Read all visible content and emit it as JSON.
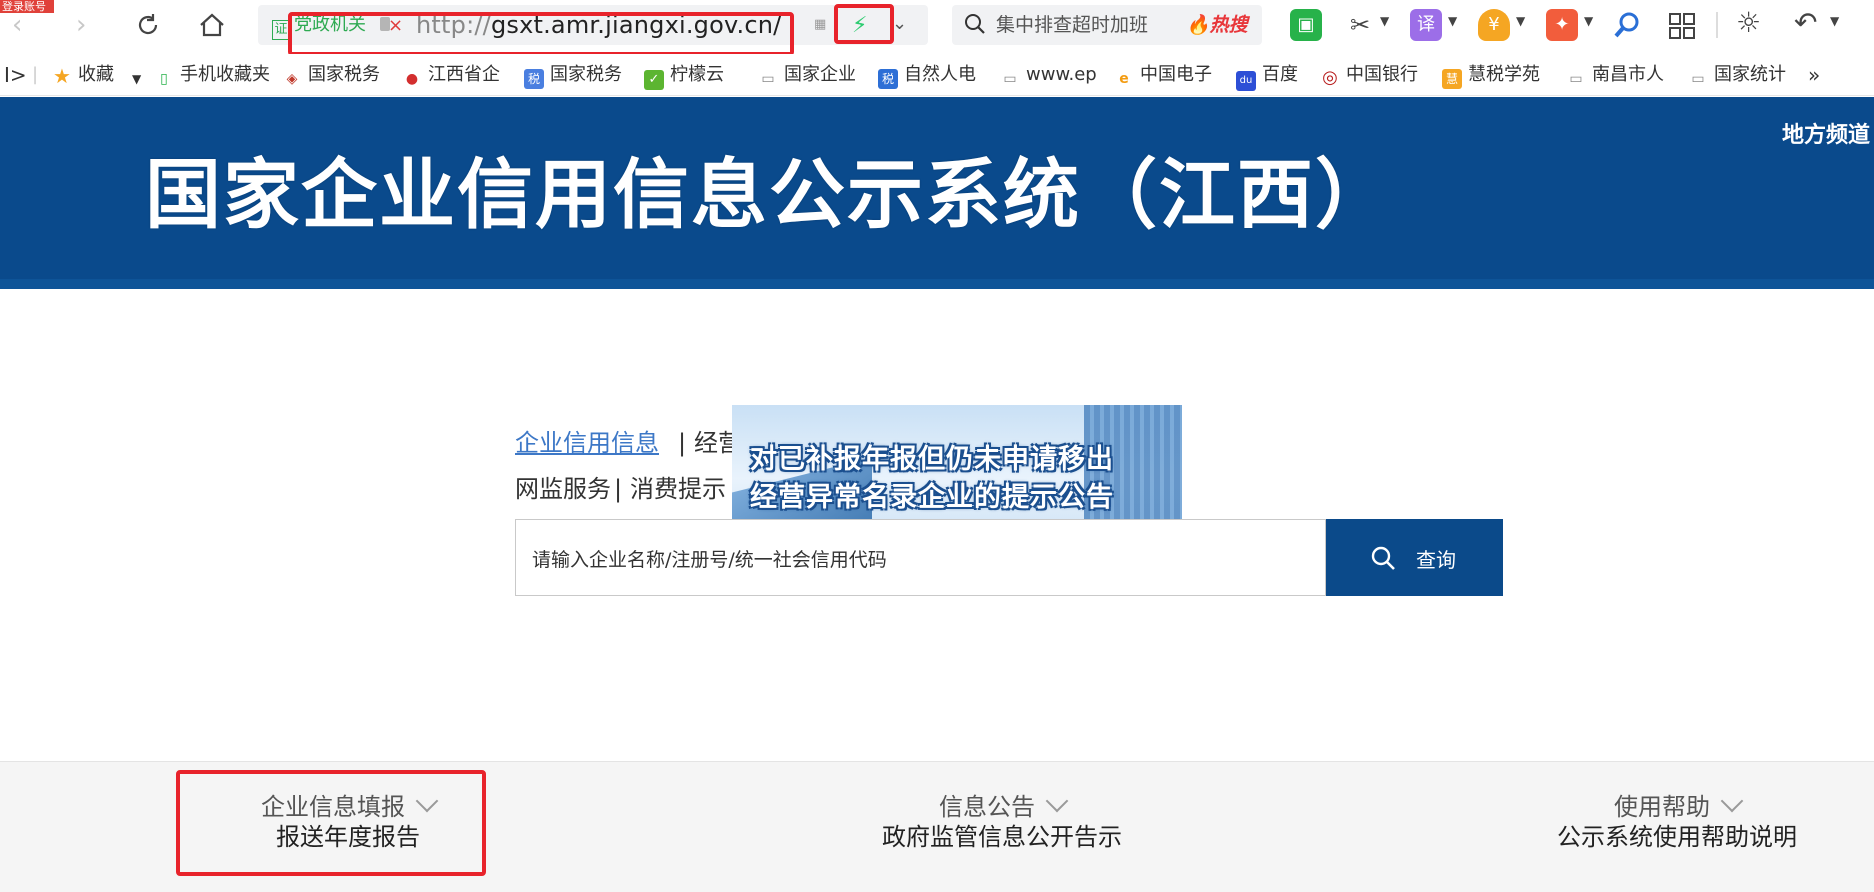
{
  "browser": {
    "corner_badge": "登录账号",
    "address": {
      "secure_label": "党政机关",
      "url_protocol": "http://",
      "url_host": "gsxt.amr.jiangxi.gov.cn/"
    },
    "search": {
      "placeholder": "集中排查超时加班",
      "hot_label": "热搜"
    },
    "icons": {
      "back": "back-arrow-icon",
      "forward": "forward-arrow-icon",
      "reload": "reload-icon",
      "home": "home-icon",
      "bolt": "lightning-bolt-icon",
      "translate_char": "译",
      "coupon_char": "¥"
    }
  },
  "bookmarks": [
    {
      "label": "收藏",
      "icon": "★"
    },
    {
      "label": "手机收藏夹",
      "icon": "▯"
    },
    {
      "label": "国家税务",
      "icon": "◈"
    },
    {
      "label": "江西省企",
      "icon": "●"
    },
    {
      "label": "国家税务",
      "icon": "税"
    },
    {
      "label": "柠檬云",
      "icon": "✓"
    },
    {
      "label": "国家企业",
      "icon": "▭"
    },
    {
      "label": "自然人电",
      "icon": "税"
    },
    {
      "label": "www.ep",
      "icon": "▭"
    },
    {
      "label": "中国电子",
      "icon": "e"
    },
    {
      "label": "百度",
      "icon": "du"
    },
    {
      "label": "中国银行",
      "icon": "◎"
    },
    {
      "label": "慧税学苑",
      "icon": "慧"
    },
    {
      "label": "南昌市人",
      "icon": "▭"
    },
    {
      "label": "国家统计",
      "icon": "▭"
    }
  ],
  "bookmarks_more": "»",
  "banner": {
    "title": "国家企业信用信息公示系统（江西）",
    "local_channel": "地方频道"
  },
  "main": {
    "tabs_row1": [
      "企业信用信息",
      "|",
      "经营"
    ],
    "tabs_row2": [
      "网监服务",
      "|",
      "消费提示"
    ],
    "popup_line1": "对已补报年报但仍未申请移出",
    "popup_line2": "经营异常名录企业的提示公告",
    "search_placeholder": "请输入企业名称/注册号/统一社会信用代码",
    "search_button": "查询"
  },
  "footer": [
    {
      "title": "企业信息填报",
      "subtitle": "报送年度报告"
    },
    {
      "title": "信息公告",
      "subtitle": "政府监管信息公开告示"
    },
    {
      "title": "使用帮助",
      "subtitle": "公示系统使用帮助说明"
    }
  ],
  "colors": {
    "banner": "#0a4a8c",
    "accent_link": "#3d78c7",
    "highlight_red": "#e8232b",
    "search_button": "#0b4a8a"
  }
}
